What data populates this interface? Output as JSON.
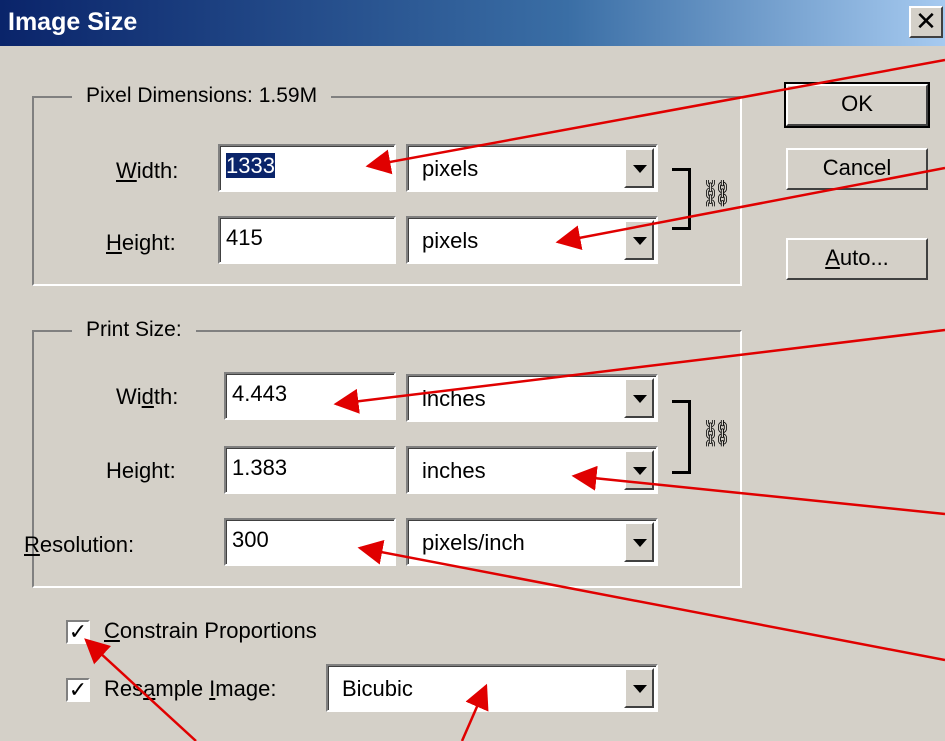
{
  "window": {
    "title": "Image Size",
    "close_glyph": "✕"
  },
  "pixel_dimensions": {
    "label": "Pixel Dimensions: 1.59M",
    "width_label": {
      "pre": "",
      "ul": "W",
      "post": "idth:"
    },
    "height_label": {
      "pre": "",
      "ul": "H",
      "post": "eight:"
    },
    "width_value": "1333",
    "height_value": "415",
    "width_unit": "pixels",
    "height_unit": "pixels"
  },
  "print_size": {
    "label": "Print Size:",
    "width_label": {
      "pre": "Wi",
      "ul": "d",
      "post": "th:"
    },
    "height_label": {
      "pre": "Hei",
      "ul": "g",
      "post": "ht:"
    },
    "resolution_label": {
      "pre": "",
      "ul": "R",
      "post": "esolution:"
    },
    "width_value": "4.443",
    "height_value": "1.383",
    "resolution_value": "300",
    "width_unit": "inches",
    "height_unit": "inches",
    "resolution_unit": "pixels/inch"
  },
  "buttons": {
    "ok": "OK",
    "cancel": "Cancel",
    "auto_ul": "A",
    "auto_rest": "uto..."
  },
  "options": {
    "constrain": {
      "pre": "",
      "ul": "C",
      "post": "onstrain Proportions",
      "checked": true
    },
    "resample": {
      "pre": "Res",
      "ul": "a",
      "post": "mple ",
      "ul2": "I",
      "post2": "mage:",
      "checked": true
    },
    "resample_method": "Bicubic"
  },
  "icons": {
    "link": "chain-link-icon",
    "check": "checkmark-icon",
    "dropdown": "dropdown-arrow-icon"
  },
  "colors": {
    "annotation": "#e00000",
    "selection": "#0a246a"
  }
}
